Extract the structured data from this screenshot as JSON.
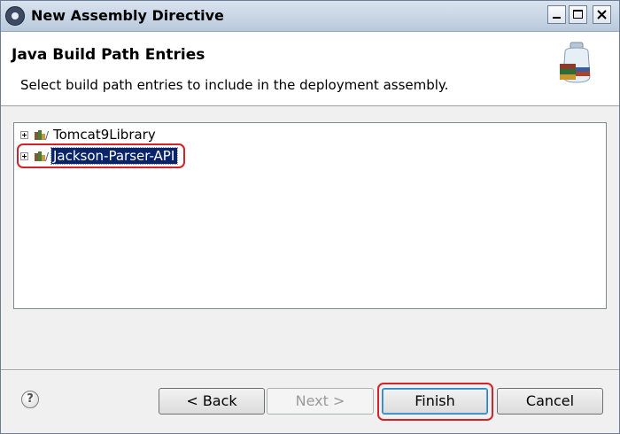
{
  "window": {
    "title": "New Assembly Directive",
    "app_icon": "eclipse-icon",
    "controls": [
      "minimize",
      "maximize",
      "close"
    ]
  },
  "banner": {
    "title": "Java Build Path Entries",
    "description": "Select build path entries to include in the deployment assembly.",
    "icon": "jar-books-icon"
  },
  "tree": {
    "items": [
      {
        "label": "Tomcat9Library",
        "icon": "library-icon",
        "expander": "plus",
        "selected": false
      },
      {
        "label": "Jackson-Parser-API",
        "icon": "library-icon",
        "expander": "plus",
        "selected": true
      }
    ]
  },
  "footer": {
    "help_label": "?",
    "back_label": "< Back",
    "next_label": "Next >",
    "finish_label": "Finish",
    "cancel_label": "Cancel"
  },
  "colors": {
    "highlight": "#d2232a",
    "selection": "#0a246a"
  }
}
